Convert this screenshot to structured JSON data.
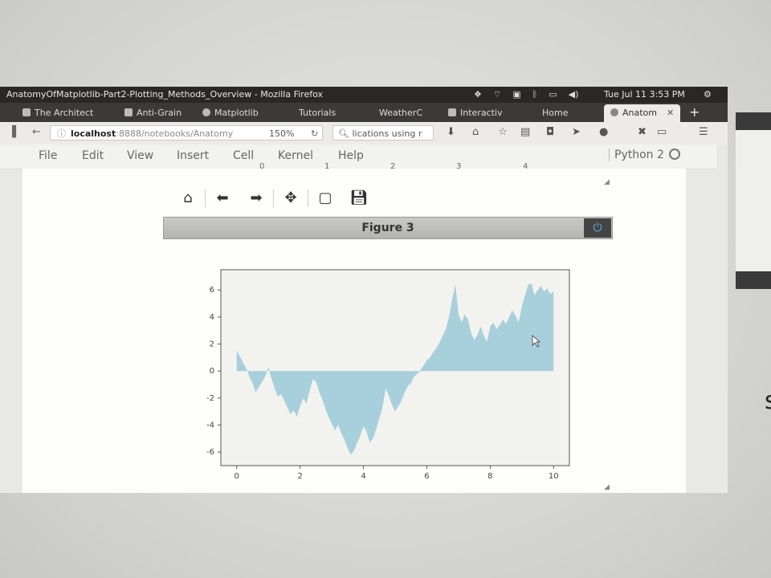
{
  "system_bar": {
    "window_title": "AnatomyOfMatplotlib-Part2-Plotting_Methods_Overview - Mozilla Firefox",
    "clock": "Tue Jul 11  3:53 PM"
  },
  "browser": {
    "tabs": [
      {
        "label": "The Architect"
      },
      {
        "label": "Anti-Grain"
      },
      {
        "label": "Matplotlib"
      },
      {
        "label": "Tutorials"
      },
      {
        "label": "WeatherC"
      },
      {
        "label": "Interactiv"
      },
      {
        "label": "Home"
      },
      {
        "label": "Anatom",
        "active": true
      }
    ],
    "url_host": "localhost",
    "url_path": ":8888/notebooks/Anatomy",
    "zoom": "150%",
    "search_value": "lications using r",
    "new_tab_symbol": "+"
  },
  "jupyter": {
    "menu": [
      "File",
      "Edit",
      "View",
      "Insert",
      "Cell",
      "Kernel",
      "Help"
    ],
    "kernel_label": "Python 2",
    "previous_cell_ticks": [
      "0",
      "1",
      "2",
      "3",
      "4"
    ],
    "figure_title": "Figure 3",
    "toolbar_icons": [
      "home-icon",
      "back-arrow-icon",
      "forward-arrow-icon",
      "move-icon",
      "zoom-rect-icon",
      "save-icon"
    ]
  },
  "chart_data": {
    "type": "area",
    "fill_color": "#a8d0dc",
    "xlim": [
      -0.5,
      10.5
    ],
    "ylim": [
      -7,
      7.5
    ],
    "xticks": [
      "0",
      "2",
      "4",
      "6",
      "8",
      "10"
    ],
    "yticks": [
      "6",
      "4",
      "2",
      "0",
      "-2",
      "-4",
      "-6"
    ],
    "x": [
      0,
      0.1,
      0.2,
      0.3,
      0.4,
      0.5,
      0.6,
      0.7,
      0.8,
      0.9,
      1.0,
      1.1,
      1.2,
      1.3,
      1.4,
      1.5,
      1.6,
      1.7,
      1.8,
      1.9,
      2.0,
      2.1,
      2.2,
      2.3,
      2.4,
      2.5,
      2.6,
      2.7,
      2.8,
      2.9,
      3.0,
      3.1,
      3.2,
      3.3,
      3.4,
      3.5,
      3.6,
      3.7,
      3.8,
      3.9,
      4.0,
      4.1,
      4.2,
      4.3,
      4.4,
      4.5,
      4.6,
      4.7,
      4.8,
      4.9,
      5.0,
      5.1,
      5.2,
      5.3,
      5.4,
      5.5,
      5.6,
      5.7,
      5.8,
      5.9,
      6.0,
      6.1,
      6.2,
      6.3,
      6.4,
      6.5,
      6.6,
      6.7,
      6.8,
      6.9,
      7.0,
      7.1,
      7.2,
      7.3,
      7.4,
      7.5,
      7.6,
      7.7,
      7.8,
      7.9,
      8.0,
      8.1,
      8.2,
      8.3,
      8.4,
      8.5,
      8.6,
      8.7,
      8.8,
      8.9,
      9.0,
      9.1,
      9.2,
      9.3,
      9.4,
      9.5,
      9.6,
      9.7,
      9.8,
      9.9,
      10.0
    ],
    "y": [
      1.5,
      1.1,
      0.6,
      0.2,
      -0.4,
      -0.9,
      -1.6,
      -1.2,
      -0.8,
      -0.4,
      0.3,
      -0.6,
      -1.3,
      -1.9,
      -1.7,
      -2.2,
      -2.7,
      -3.2,
      -2.9,
      -3.4,
      -2.6,
      -2.0,
      -2.4,
      -1.5,
      -0.6,
      -0.8,
      -1.5,
      -2.1,
      -2.8,
      -3.4,
      -3.9,
      -4.4,
      -4.0,
      -4.6,
      -5.1,
      -5.7,
      -6.2,
      -5.9,
      -5.3,
      -4.8,
      -4.1,
      -4.5,
      -5.3,
      -5.0,
      -4.3,
      -3.5,
      -2.7,
      -1.3,
      -1.8,
      -2.5,
      -3.0,
      -2.6,
      -2.2,
      -1.6,
      -1.1,
      -0.9,
      -0.4,
      -0.2,
      0.1,
      0.4,
      0.8,
      1.0,
      1.4,
      1.7,
      2.1,
      2.6,
      3.1,
      4.0,
      5.3,
      6.4,
      4.2,
      3.6,
      4.2,
      3.8,
      2.8,
      2.3,
      2.7,
      3.3,
      2.6,
      2.2,
      3.3,
      3.6,
      3.1,
      3.4,
      3.8,
      3.5,
      4.0,
      4.5,
      4.1,
      3.6,
      4.8,
      5.6,
      6.4,
      6.5,
      5.6,
      6.0,
      6.3,
      5.9,
      6.1,
      5.7,
      5.9
    ]
  }
}
